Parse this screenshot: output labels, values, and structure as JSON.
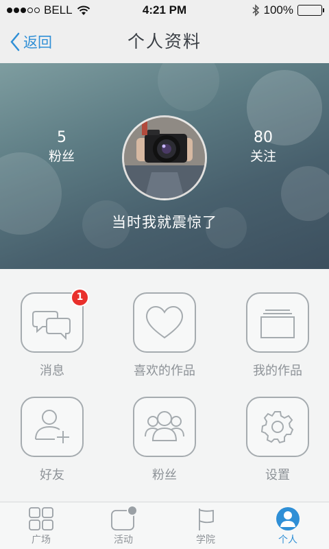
{
  "status_bar": {
    "carrier": "BELL",
    "time": "4:21 PM",
    "battery": "100%",
    "signal_icon": "signal-dots-icon",
    "wifi_icon": "wifi-icon",
    "bluetooth_icon": "bluetooth-icon"
  },
  "nav": {
    "back_label": "返回",
    "title": "个人资料"
  },
  "profile": {
    "fans_count": "5",
    "fans_label": "粉丝",
    "follow_count": "80",
    "follow_label": "关注",
    "username": "当时我就震惊了",
    "avatar_icon": "camera-photo-avatar"
  },
  "menu": {
    "items": [
      {
        "label": "消息",
        "icon": "chat-bubbles-icon",
        "badge": "1"
      },
      {
        "label": "喜欢的作品",
        "icon": "heart-icon"
      },
      {
        "label": "我的作品",
        "icon": "stacked-cards-icon"
      },
      {
        "label": "好友",
        "icon": "add-friend-icon"
      },
      {
        "label": "粉丝",
        "icon": "group-icon"
      },
      {
        "label": "设置",
        "icon": "gear-icon"
      }
    ]
  },
  "tabs": [
    {
      "label": "广场",
      "icon": "grid-icon"
    },
    {
      "label": "活动",
      "icon": "activity-icon"
    },
    {
      "label": "学院",
      "icon": "flag-icon"
    },
    {
      "label": "个人",
      "icon": "person-icon",
      "active": true
    }
  ],
  "colors": {
    "accent": "#2f8fd6",
    "badge": "#e9302c",
    "icon_gray": "#a5abaf"
  }
}
